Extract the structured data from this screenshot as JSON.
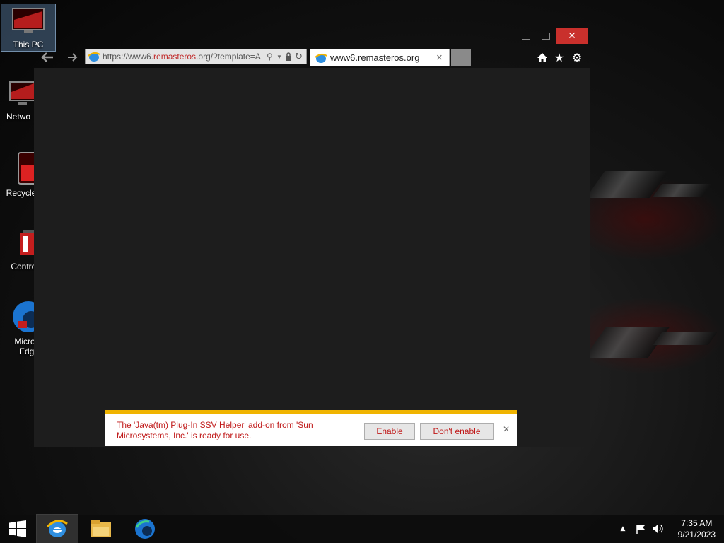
{
  "desktop": {
    "icons": [
      {
        "label": "This PC",
        "icon": "monitor-icon"
      },
      {
        "label": "Netwo",
        "icon": "network-icon"
      },
      {
        "label": "Recycle",
        "icon": "recycle-bin-icon"
      },
      {
        "label": "Control I",
        "icon": "control-panel-icon"
      },
      {
        "label": "Micros\nEdge",
        "label_line1": "Micros",
        "label_line2": "Edge",
        "icon": "edge-icon"
      }
    ]
  },
  "browser": {
    "address_prefix": "https://www6.",
    "address_highlight": "remasteros",
    "address_suffix": ".org/?template=A",
    "tab_title": "www6.remasteros.org",
    "close_label": "✕",
    "tab_close_label": "×"
  },
  "notification": {
    "message": "The 'Java(tm) Plug-In SSV Helper' add-on from 'Sun Microsystems, Inc.' is ready for use.",
    "enable_label": "Enable",
    "dont_enable_label": "Don't enable",
    "close_label": "×"
  },
  "taskbar": {
    "time": "7:35 AM",
    "date": "9/21/2023"
  },
  "colors": {
    "accent_red": "#c9302c",
    "notification_border": "#f0b400",
    "notification_text": "#c01919"
  }
}
